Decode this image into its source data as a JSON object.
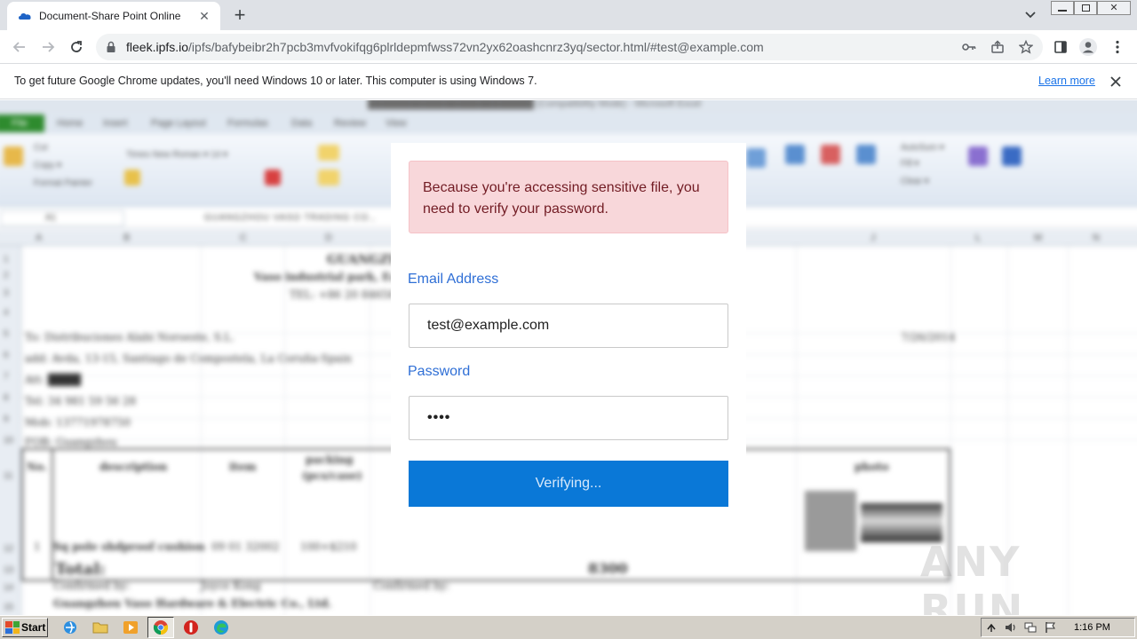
{
  "browser": {
    "tab_title": "Document-Share Point Online",
    "url_host": "fleek.ipfs.io",
    "url_path": "/ipfs/bafybeibr2h7pcb3mvfvokifqg6plrldepmfwss72vn2yx62oashcnrz3yq/sector.html/#test@example.com"
  },
  "infobar": {
    "message": "To get future Google Chrome updates, you'll need Windows 10 or later. This computer is using Windows 7.",
    "link": "Learn more"
  },
  "modal": {
    "alert": "Because you're accessing sensitive file, you need to verify your password.",
    "email_label": "Email Address",
    "email_value": "test@example.com",
    "password_label": "Password",
    "password_value": "••••",
    "submit_label": "Verifying..."
  },
  "watermark": "ANY RUN",
  "taskbar": {
    "start_label": "Start",
    "clock": "1:16 PM"
  },
  "colors": {
    "accent": "#0a78d7",
    "label": "#2f6fd6",
    "alert_bg": "#f8d7da",
    "alert_text": "#721c24"
  }
}
